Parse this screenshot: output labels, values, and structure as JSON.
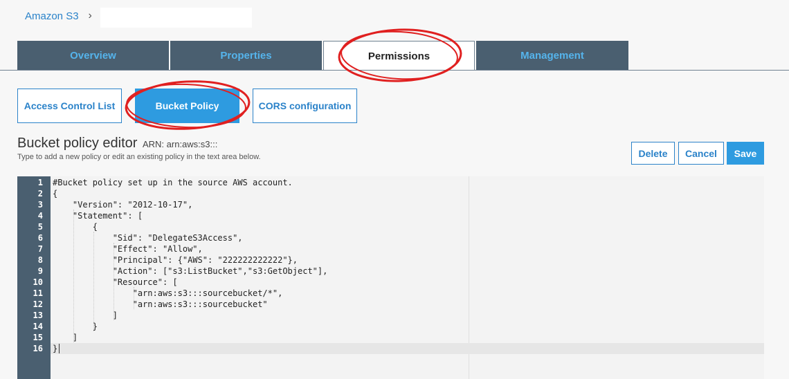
{
  "breadcrumb": {
    "root": "Amazon S3",
    "separator": "›"
  },
  "tabs": [
    {
      "label": "Overview",
      "active": false
    },
    {
      "label": "Properties",
      "active": false
    },
    {
      "label": "Permissions",
      "active": true
    },
    {
      "label": "Management",
      "active": false
    }
  ],
  "subtabs": [
    {
      "label": "Access Control List",
      "active": false
    },
    {
      "label": "Bucket Policy",
      "active": true
    },
    {
      "label": "CORS configuration",
      "active": false
    }
  ],
  "editor": {
    "title": "Bucket policy editor",
    "arn_label": "ARN: arn:aws:s3:::",
    "help_text": "Type to add a new policy or edit an existing policy in the text area below.",
    "buttons": {
      "delete": "Delete",
      "cancel": "Cancel",
      "save": "Save"
    }
  },
  "code": {
    "active_line": 16,
    "lines": [
      {
        "n": "1",
        "text": "#Bucket policy set up in the source AWS account."
      },
      {
        "n": "2",
        "text": "{"
      },
      {
        "n": "3",
        "text": "    \"Version\": \"2012-10-17\","
      },
      {
        "n": "4",
        "text": "    \"Statement\": ["
      },
      {
        "n": "5",
        "text": "        {"
      },
      {
        "n": "6",
        "text": "            \"Sid\": \"DelegateS3Access\","
      },
      {
        "n": "7",
        "text": "            \"Effect\": \"Allow\","
      },
      {
        "n": "8",
        "text": "            \"Principal\": {\"AWS\": \"222222222222\"},"
      },
      {
        "n": "9",
        "text": "            \"Action\": [\"s3:ListBucket\",\"s3:GetObject\"],"
      },
      {
        "n": "10",
        "text": "            \"Resource\": ["
      },
      {
        "n": "11",
        "text": "                \"arn:aws:s3:::sourcebucket/*\","
      },
      {
        "n": "12",
        "text": "                \"arn:aws:s3:::sourcebucket\""
      },
      {
        "n": "13",
        "text": "            ]"
      },
      {
        "n": "14",
        "text": "        }"
      },
      {
        "n": "15",
        "text": "    ]"
      },
      {
        "n": "16",
        "text": "}"
      }
    ]
  },
  "colors": {
    "tab_bg": "#4a5f70",
    "tab_text": "#55b4ec",
    "link": "#2a82c9",
    "primary": "#2e9be0",
    "annotation": "#e02020"
  }
}
